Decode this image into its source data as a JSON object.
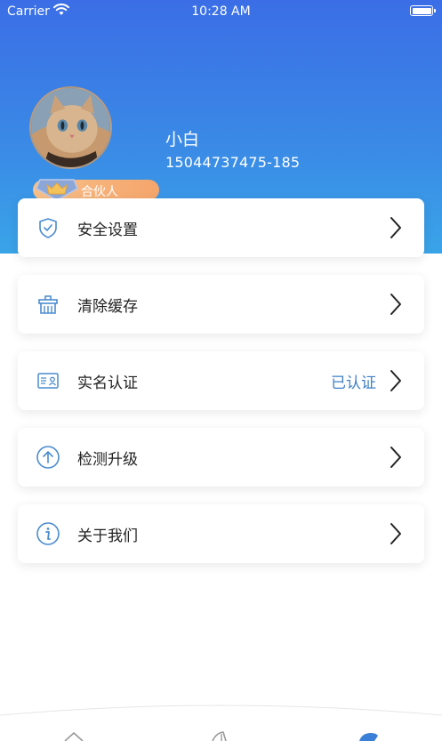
{
  "status_bar": {
    "carrier": "Carrier",
    "time": "10:28 AM"
  },
  "profile": {
    "name": "小白",
    "user_id": "15044737475-185",
    "badge_label": "合伙人"
  },
  "menu": [
    {
      "label": "安全设置",
      "icon": "shield-icon",
      "status": ""
    },
    {
      "label": "清除缓存",
      "icon": "trash-basket-icon",
      "status": ""
    },
    {
      "label": "实名认证",
      "icon": "id-card-icon",
      "status": "已认证"
    },
    {
      "label": "检测升级",
      "icon": "upgrade-arrow-icon",
      "status": ""
    },
    {
      "label": "关于我们",
      "icon": "info-icon",
      "status": ""
    }
  ],
  "tabbar": {
    "icons": [
      "home-tab-icon",
      "discover-tab-icon",
      "profile-tab-icon"
    ]
  },
  "colors": {
    "header_gradient_top": "#3b6ee6",
    "header_gradient_bottom": "#3aa4e8",
    "accent": "#3f7fc9",
    "badge_orange": "#f5a56b"
  }
}
